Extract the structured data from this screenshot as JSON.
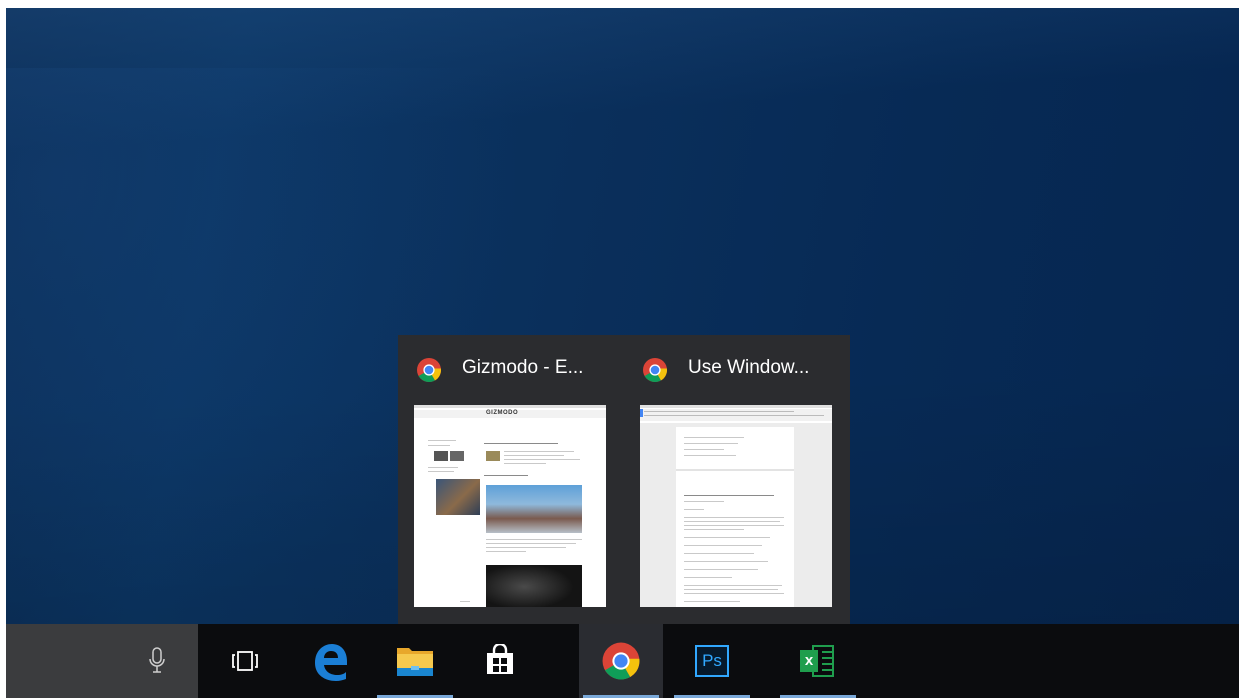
{
  "preview": {
    "windows": [
      {
        "title": "Gizmodo - E...",
        "icon": "chrome-icon",
        "site_header": "GIZMODO"
      },
      {
        "title": "Use Window...",
        "icon": "chrome-icon"
      }
    ]
  },
  "taskbar": {
    "cortana_icon": "microphone-icon",
    "buttons": [
      {
        "name": "task-view",
        "icon": "task-view-icon"
      },
      {
        "name": "edge",
        "icon": "edge-icon"
      },
      {
        "name": "file-explorer",
        "icon": "folder-icon"
      },
      {
        "name": "store",
        "icon": "store-icon"
      },
      {
        "name": "chrome",
        "icon": "chrome-icon",
        "active": true
      },
      {
        "name": "photoshop",
        "icon": "photoshop-icon",
        "label": "Ps"
      },
      {
        "name": "excel",
        "icon": "excel-icon",
        "label": "x"
      }
    ]
  },
  "colors": {
    "taskbar": "#0b0c0e",
    "cortana": "#3b3c3e",
    "flyout": "#2b2c2f",
    "accent": "#7aa9d9",
    "photoshop": "#31a8ff",
    "excel": "#1f9e4d"
  }
}
